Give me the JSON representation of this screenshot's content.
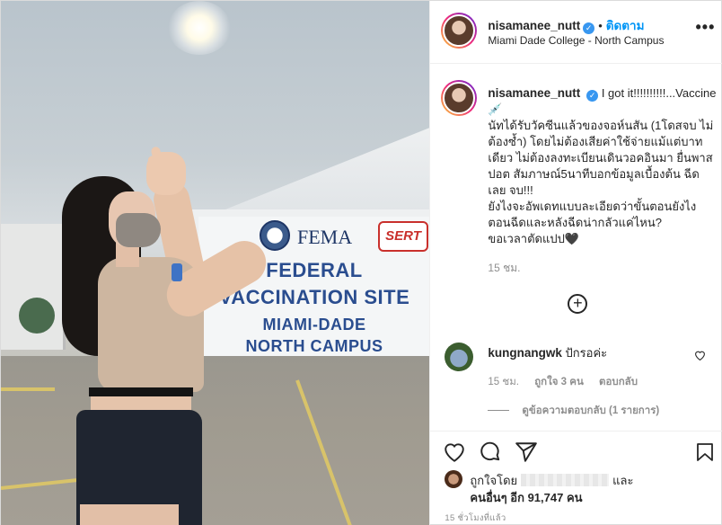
{
  "photo": {
    "banner_lines": [
      "FEDERAL",
      "VACCINATION SITE",
      "MIAMI-DADE",
      "NORTH CAMPUS"
    ],
    "fema": "FEMA",
    "sert": "SERT"
  },
  "header": {
    "username": "nisamanee_nutt",
    "verified_mark": "✓",
    "separator": "•",
    "follow_label": "ติดตาม",
    "location": "Miami Dade College - North Campus",
    "more_label": "•••"
  },
  "caption": {
    "username": "nisamanee_nutt",
    "text_line1": "I got it!!!!!!!!!!...Vaccine💉",
    "text_body": "นัทได้รับวัคซีนแล้วของจอห์นสัน (1โดสจบ ไม่ต้องซ้ำ) โดยไม่ต้องเสียค่าใช้จ่ายแม้แต่บาทเดียว ไม่ต้องลงทะเบียนเดินวอคอินมา ยื่นพาสปอต สัมภาษณ์5นาทีบอกข้อมูลเบื้องต้น ฉีดเลย จบ!!!",
    "text_body2": "ยังไงจะอัพเดทแบบละเอียดว่าขั้นตอนยังไง ตอนฉีดและหลังฉีดน่ากลัวแค่ไหน?",
    "text_body3": "ขอเวลาตัดแปป🖤",
    "time": "15 ชม.",
    "add_label": "+"
  },
  "comment": {
    "username": "kungnangwk",
    "text": "ปักรอค่ะ",
    "time": "15 ชม.",
    "likes": "ถูกใจ 3 คน",
    "reply": "ตอบกลับ",
    "view_replies": "ดูข้อความตอบกลับ (1 รายการ)"
  },
  "likes": {
    "prefix": "ถูกใจโดย",
    "suffix": "และ",
    "others": "คนอื่นๆ อีก 91,747 คน"
  },
  "age": "15 ชั่วโมงที่แล้ว"
}
